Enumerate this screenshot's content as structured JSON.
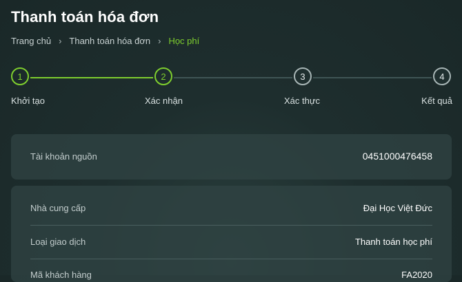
{
  "title": "Thanh toán hóa đơn",
  "breadcrumb": {
    "items": [
      "Trang chủ",
      "Thanh toán hóa đơn"
    ],
    "current": "Học phí",
    "separator": "›"
  },
  "stepper": {
    "current_step": 2,
    "steps": [
      {
        "number": "1",
        "label": "Khởi tạo",
        "state": "done"
      },
      {
        "number": "2",
        "label": "Xác nhận",
        "state": "active"
      },
      {
        "number": "3",
        "label": "Xác thực",
        "state": "pending"
      },
      {
        "number": "4",
        "label": "Kết quả",
        "state": "pending"
      }
    ]
  },
  "source_account": {
    "label": "Tài khoản nguồn",
    "value": "0451000476458"
  },
  "details": [
    {
      "label": "Nhà cung cấp",
      "value": "Đại Học Việt Đức"
    },
    {
      "label": "Loại giao dịch",
      "value": "Thanh toán học phí"
    },
    {
      "label": "Mã khách hàng",
      "value": "FA2020"
    }
  ],
  "colors": {
    "accent": "#7fcf2e",
    "background": "#1e2e2e",
    "card": "#304242",
    "pending_line": "#3f5555"
  }
}
